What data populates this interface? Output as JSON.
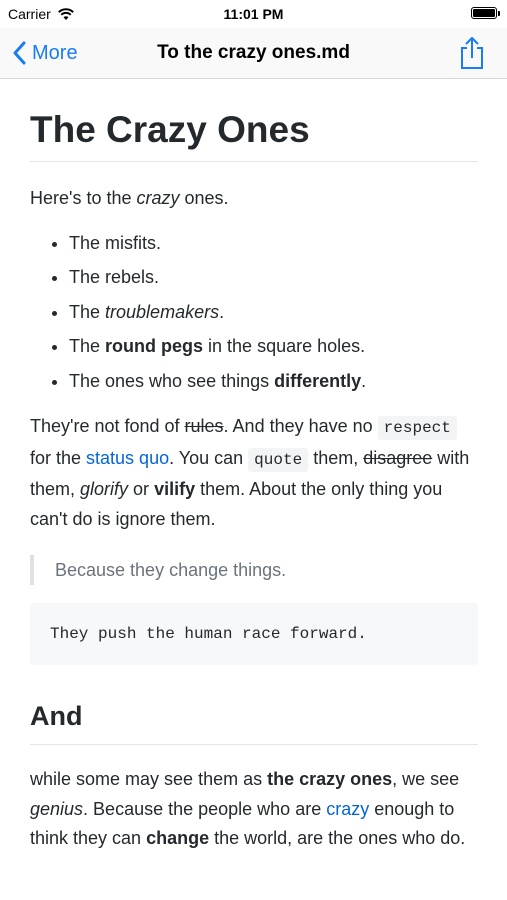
{
  "status_bar": {
    "carrier": "Carrier",
    "time": "11:01 PM"
  },
  "nav": {
    "back_label": "More",
    "title": "To the crazy ones.md"
  },
  "doc": {
    "h1": "The Crazy Ones",
    "intro": {
      "a": "Here's to the ",
      "em": "crazy",
      "b": " ones."
    },
    "list": {
      "i1": "The misfits.",
      "i2": "The rebels.",
      "i3": {
        "a": "The ",
        "em": "troublemakers",
        "b": "."
      },
      "i4": {
        "a": "The ",
        "strong": "round pegs",
        "b": " in the square holes."
      },
      "i5": {
        "a": "The ones who see things ",
        "strong": "differently",
        "b": "."
      }
    },
    "para2": {
      "t1": "They're not fond of ",
      "del1": "rules",
      "t2": ". And they have no ",
      "code1": "respect",
      "t3": " for the ",
      "link1": "status quo",
      "t4": ". You can ",
      "code2": "quote",
      "t5": " them, ",
      "del2": "disagree",
      "t6": " with them, ",
      "em1": "glorify",
      "t7": " or ",
      "strong1": "vilify",
      "t8": " them. About the only thing you can't do is ignore them."
    },
    "blockquote": "Because they change things.",
    "code_block": "They push the human race forward.",
    "h2": "And",
    "para3": {
      "t1": "while some may see them as ",
      "strong1": "the crazy ones",
      "t2": ", we see ",
      "em1": "genius",
      "t3": ". Because the people who are ",
      "link1": "crazy",
      "t4": " enough to think they can ",
      "strong2": "change",
      "t5": " the world, are the ones who do."
    }
  }
}
